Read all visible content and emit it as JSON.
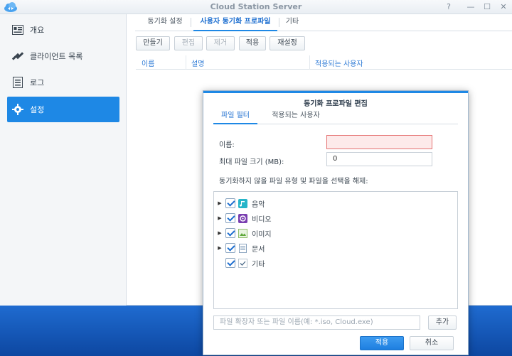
{
  "window": {
    "title": "Cloud Station Server"
  },
  "colors": {
    "accent": "#1e88e5",
    "error": "#e57373"
  },
  "sidebar": {
    "items": [
      {
        "label": "개요",
        "icon": "overview-icon",
        "active": false
      },
      {
        "label": "클라이언트 목록",
        "icon": "satellite-icon",
        "active": false
      },
      {
        "label": "로그",
        "icon": "log-icon",
        "active": false
      },
      {
        "label": "설정",
        "icon": "gear-icon",
        "active": true
      }
    ]
  },
  "tabs": [
    {
      "label": "동기화 설정"
    },
    {
      "label": "사용자 동기화 프로파일"
    },
    {
      "label": "기타"
    }
  ],
  "toolbar": {
    "create": "만들기",
    "edit": "편집",
    "delete": "제거",
    "apply": "적용",
    "reset": "재설정"
  },
  "grid": {
    "columns": [
      "이름",
      "설명",
      "적용되는 사용자"
    ]
  },
  "dialog": {
    "title": "동기화 프로파일 편집",
    "tabs": [
      "파일 필터",
      "적용되는 사용자"
    ],
    "name_label": "이름:",
    "name_value": "",
    "max_size_label": "최대 파일 크기 (MB):",
    "max_size_value": "0",
    "exclude_label": "동기화하지 않을 파일 유형 및 파일을 선택을 해제:",
    "file_types": [
      {
        "label": "음악",
        "icon": "music-icon",
        "expandable": true
      },
      {
        "label": "비디오",
        "icon": "video-icon",
        "expandable": true
      },
      {
        "label": "이미지",
        "icon": "image-icon",
        "expandable": true
      },
      {
        "label": "문서",
        "icon": "document-icon",
        "expandable": true
      },
      {
        "label": "기타",
        "icon": "other-icon",
        "expandable": false
      }
    ],
    "ext_placeholder": "파일 확장자 또는 파일 이름(예: *.iso, Cloud.exe)",
    "add_label": "추가",
    "apply_label": "적용",
    "cancel_label": "취소"
  }
}
